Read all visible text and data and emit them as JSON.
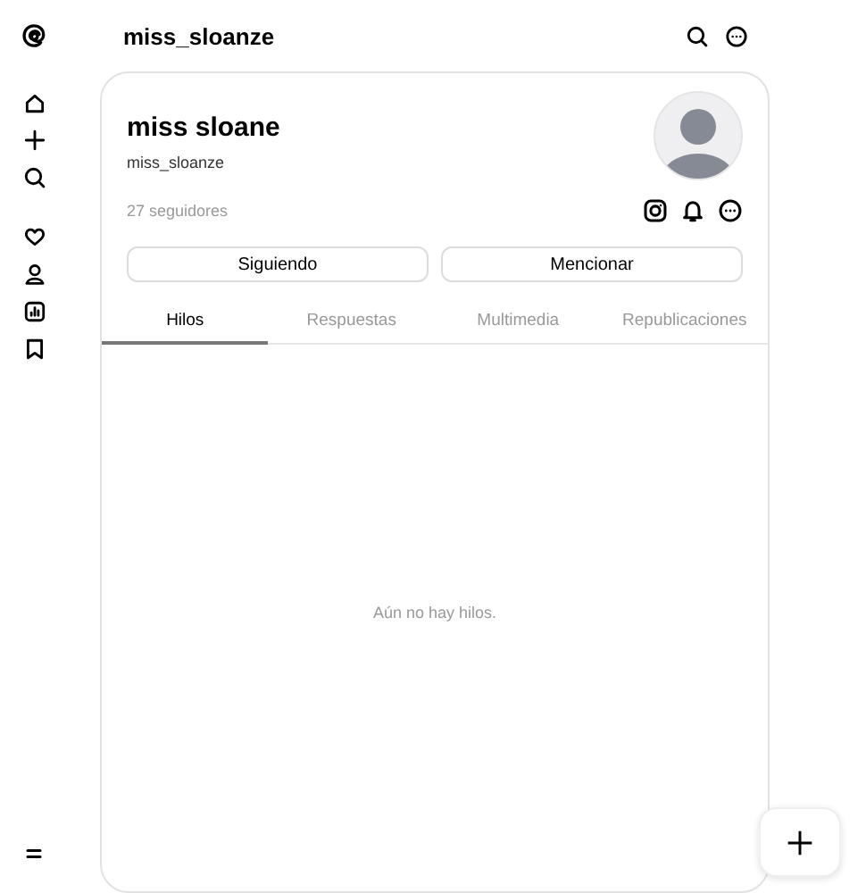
{
  "header": {
    "title": "miss_sloanze"
  },
  "profile": {
    "name": "miss sloane",
    "handle": "miss_sloanze",
    "followers": "27 seguidores"
  },
  "buttons": [
    "Siguiendo",
    "Mencionar"
  ],
  "tabs": [
    {
      "label": "Hilos",
      "selected": true
    },
    {
      "label": "Respuestas",
      "selected": false
    },
    {
      "label": "Multimedia",
      "selected": false
    },
    {
      "label": "Republicaciones",
      "selected": false
    }
  ],
  "empty_message": "Aún no hay hilos."
}
